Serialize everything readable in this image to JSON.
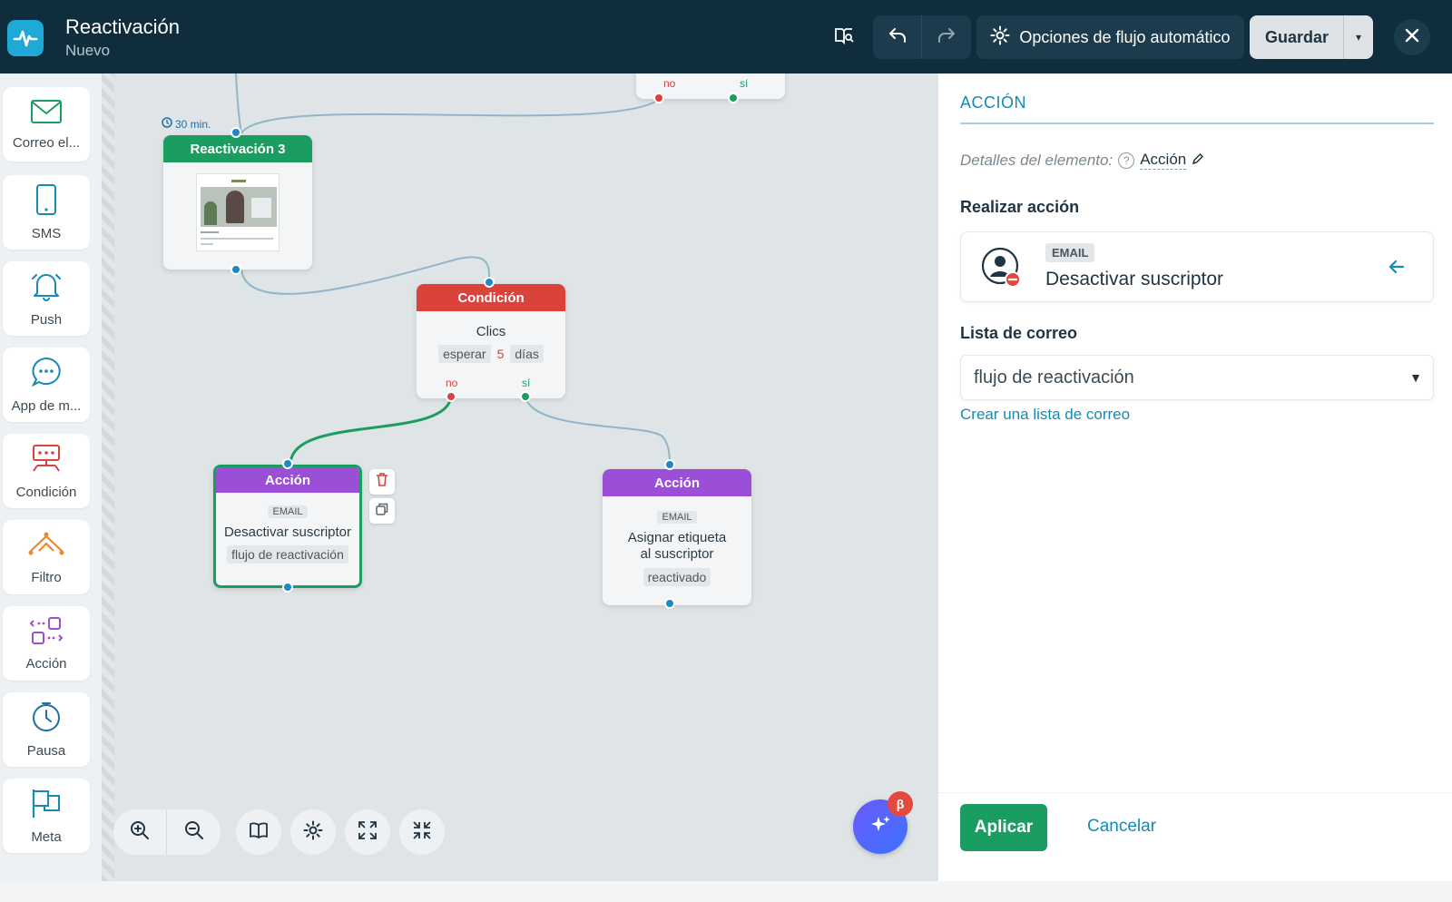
{
  "header": {
    "title": "Reactivación",
    "subtitle": "Nuevo",
    "options_label": "Opciones de flujo automático",
    "save_label": "Guardar"
  },
  "palette": {
    "items": [
      {
        "label": "Correo el...",
        "icon": "mail-icon"
      },
      {
        "label": "SMS",
        "icon": "phone-icon"
      },
      {
        "label": "Push",
        "icon": "bell-icon"
      },
      {
        "label": "App de m...",
        "icon": "chat-icon"
      },
      {
        "label": "Condición",
        "icon": "condition-icon"
      },
      {
        "label": "Filtro",
        "icon": "filter-icon"
      },
      {
        "label": "Acción",
        "icon": "action-icon"
      },
      {
        "label": "Pausa",
        "icon": "clock-icon"
      },
      {
        "label": "Meta",
        "icon": "flag-icon"
      }
    ]
  },
  "canvas": {
    "top_node": {
      "no": "no",
      "si": "sí"
    },
    "email_node": {
      "delay": "30 min.",
      "title": "Reactivación 3"
    },
    "condition_node": {
      "title": "Condición",
      "event": "Clics",
      "wait_label": "esperar",
      "wait_value": "5",
      "wait_unit": "días",
      "no": "no",
      "si": "sí"
    },
    "action_left": {
      "title": "Acción",
      "badge": "EMAIL",
      "text": "Desactivar suscriptor",
      "chip": "flujo de reactivación"
    },
    "action_right": {
      "title": "Acción",
      "badge": "EMAIL",
      "text_line1": "Asignar etiqueta",
      "text_line2": "al suscriptor",
      "chip": "reactivado"
    },
    "beta_label": "β"
  },
  "panel": {
    "title": "ACCIÓN",
    "details_label": "Detalles del elemento:",
    "details_value": "Acción",
    "perform_label": "Realizar acción",
    "action_badge": "EMAIL",
    "action_name": "Desactivar suscriptor",
    "list_label": "Lista de correo",
    "list_value": "flujo de reactivación",
    "create_list_link": "Crear una lista de correo",
    "apply_label": "Aplicar",
    "cancel_label": "Cancelar"
  },
  "colors": {
    "header_bg": "#0f2d3d",
    "accent_blue": "#1789b5",
    "green": "#1b9d62",
    "condition_red": "#d9433c",
    "action_purple": "#9b4fd6"
  }
}
